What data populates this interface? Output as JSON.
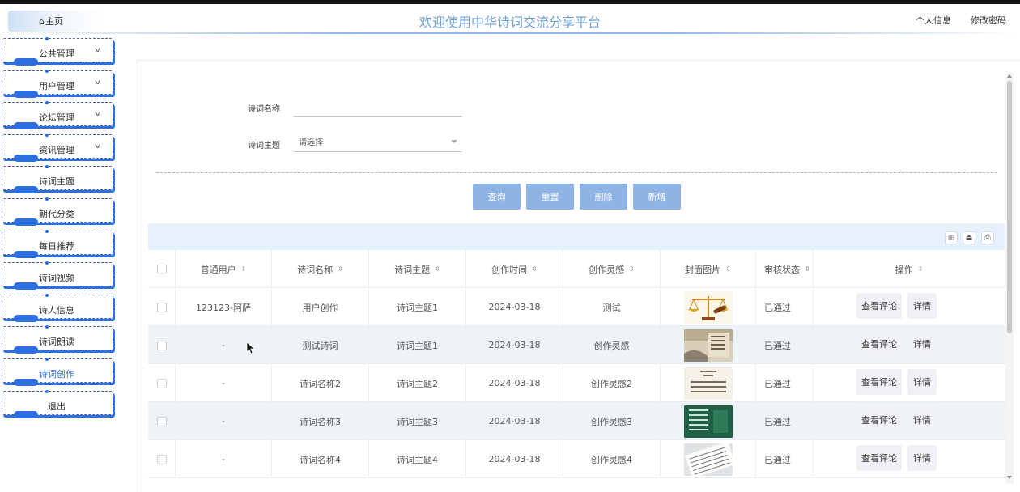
{
  "header": {
    "home_label": "主页",
    "home_icon": "home-icon",
    "title": "欢迎使用中华诗词交流分享平台",
    "profile_link": "个人信息",
    "password_link": "修改密码"
  },
  "menu": {
    "items": [
      {
        "label": "公共管理",
        "has_dropdown": true
      },
      {
        "label": "用户管理",
        "has_dropdown": true
      },
      {
        "label": "论坛管理",
        "has_dropdown": true
      },
      {
        "label": "资讯管理",
        "has_dropdown": true
      },
      {
        "label": "诗词主题",
        "has_dropdown": false
      },
      {
        "label": "朝代分类",
        "has_dropdown": false
      },
      {
        "label": "每日推荐",
        "has_dropdown": false
      },
      {
        "label": "诗词视频",
        "has_dropdown": false
      },
      {
        "label": "诗人信息",
        "has_dropdown": false
      },
      {
        "label": "诗词朗读",
        "has_dropdown": false
      },
      {
        "label": "诗词创作",
        "has_dropdown": false,
        "active": true
      },
      {
        "label": "退出",
        "has_dropdown": false
      }
    ]
  },
  "search": {
    "name_label": "诗词名称",
    "name_value": "",
    "theme_label": "诗词主题",
    "theme_value": "请选择"
  },
  "actions": {
    "query": "查询",
    "reset": "重置",
    "delete": "删除",
    "add": "新增"
  },
  "toolbar_icons": [
    "columns-icon",
    "export-icon",
    "print-icon"
  ],
  "table": {
    "headers": [
      "普通用户",
      "诗词名称",
      "诗词主题",
      "创作时间",
      "创作灵感",
      "封面图片",
      "审核状态",
      "操作"
    ],
    "rows": [
      {
        "user": "123123-阿萨",
        "name": "用户创作",
        "theme": "诗词主题1",
        "time": "2024-03-18",
        "inspiration": "测试",
        "cover": "scales-of-justice-image",
        "status": "已通过",
        "comment_btn": "查看评论",
        "detail_btn": "详情"
      },
      {
        "user": "-",
        "name": "测试诗词",
        "theme": "诗词主题1",
        "time": "2024-03-18",
        "inspiration": "创作灵感",
        "cover": "poem-scroll-image",
        "status": "已通过",
        "comment_btn": "查看评论",
        "detail_btn": "详情"
      },
      {
        "user": "-",
        "name": "诗词名称2",
        "theme": "诗词主题2",
        "time": "2024-03-18",
        "inspiration": "创作灵感2",
        "cover": "poem-text-image",
        "status": "已通过",
        "comment_btn": "查看评论",
        "detail_btn": "详情"
      },
      {
        "user": "-",
        "name": "诗词名称3",
        "theme": "诗词主题3",
        "time": "2024-03-18",
        "inspiration": "创作灵感3",
        "cover": "green-poem-board-image",
        "status": "已通过",
        "comment_btn": "查看评论",
        "detail_btn": "详情"
      },
      {
        "user": "-",
        "name": "诗词名称4",
        "theme": "诗词主题4",
        "time": "2024-03-18",
        "inspiration": "创作灵感4",
        "cover": "handwriting-paper-image",
        "status": "已通过",
        "comment_btn": "查看评论",
        "detail_btn": "详情"
      }
    ]
  },
  "colors": {
    "accent": "#2d6fe0",
    "title": "#6f9fd4",
    "button": "#8fb3e4",
    "toolbar": "#e7f1fc"
  }
}
